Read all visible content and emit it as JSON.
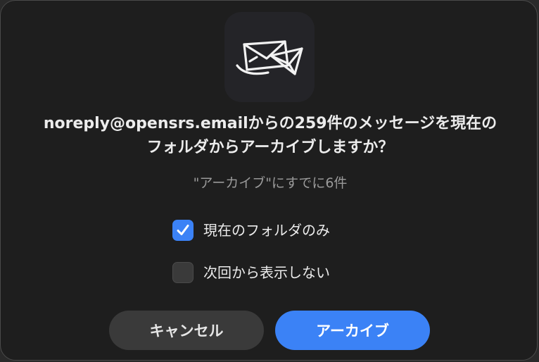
{
  "dialog": {
    "message_line1": "noreply@opensrs.emailからの259件のメッセージを現在の",
    "message_line2": "フォルダからアーカイブしますか？",
    "subtext": "\"アーカイブ\"にすでに6件"
  },
  "options": [
    {
      "label": "現在のフォルダのみ",
      "checked": true
    },
    {
      "label": "次回から表示しない",
      "checked": false
    }
  ],
  "buttons": {
    "cancel_label": "キャンセル",
    "archive_label": "アーカイブ"
  },
  "colors": {
    "accent": "#3b82f6",
    "dialog_bg": "#1e1e1e",
    "secondary_button": "#3a3a3a"
  },
  "icons": {
    "app_icon": "mail-envelopes-icon",
    "checkmark": "checkmark-icon"
  }
}
